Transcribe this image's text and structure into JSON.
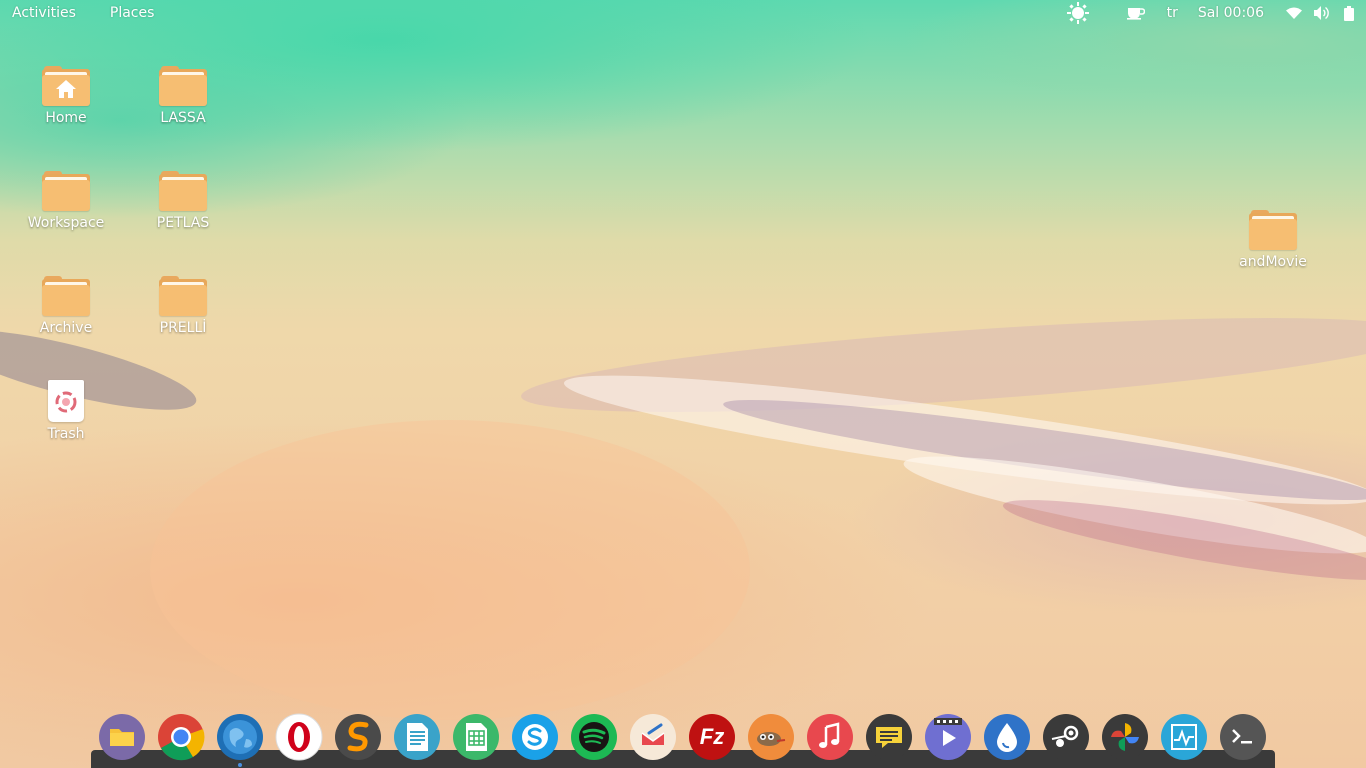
{
  "topbar": {
    "activities": "Activities",
    "places": "Places",
    "keyboard_layout": "tr",
    "clock": "Sal 00:06",
    "tray_icons": [
      "weather-sun-icon",
      "coffee-cup-icon",
      "wifi-icon",
      "volume-icon",
      "battery-icon"
    ]
  },
  "desktop_icons": [
    {
      "label": "Home",
      "icon": "home-folder-icon"
    },
    {
      "label": "LASSA",
      "icon": "folder-icon"
    },
    {
      "label": "Workspace",
      "icon": "folder-icon"
    },
    {
      "label": "PETLAS",
      "icon": "folder-icon"
    },
    {
      "label": "Archive",
      "icon": "folder-icon"
    },
    {
      "label": "PRELLİ",
      "icon": "folder-icon"
    },
    {
      "label": "Trash",
      "icon": "trash-icon"
    },
    {
      "label": "andMovie",
      "icon": "folder-icon"
    }
  ],
  "dock": {
    "apps": [
      {
        "icon": "files-icon",
        "color": "#7b6aa8"
      },
      {
        "icon": "chrome-icon",
        "color": "#e0e0e0"
      },
      {
        "icon": "web-browser-globe-icon",
        "color": "#1e6fb5"
      },
      {
        "icon": "opera-icon",
        "color": "#ffffff"
      },
      {
        "icon": "sublime-text-icon",
        "color": "#4a4a4a"
      },
      {
        "icon": "text-document-icon",
        "color": "#3aa3c9"
      },
      {
        "icon": "spreadsheet-icon",
        "color": "#3cb86a"
      },
      {
        "icon": "skype-icon",
        "color": "#1aa1e8"
      },
      {
        "icon": "spotify-icon",
        "color": "#1db954"
      },
      {
        "icon": "mail-icon",
        "color": "#f6e9d8"
      },
      {
        "icon": "filezilla-icon",
        "color": "#bf1111"
      },
      {
        "icon": "gimp-icon",
        "color": "#f08c3c"
      },
      {
        "icon": "music-icon",
        "color": "#e8484e"
      },
      {
        "icon": "chat-messages-icon",
        "color": "#3a3a3a"
      },
      {
        "icon": "video-player-icon",
        "color": "#6f6fd1"
      },
      {
        "icon": "drop-icon",
        "color": "#2f73c8"
      },
      {
        "icon": "steam-icon",
        "color": "#3a3a3a"
      },
      {
        "icon": "pinwheel-icon",
        "color": "#3a3a3a"
      },
      {
        "icon": "system-monitor-icon",
        "color": "#2aa6d8"
      },
      {
        "icon": "terminal-icon",
        "color": "#555555"
      }
    ],
    "active_app": "web-browser-globe-icon"
  }
}
